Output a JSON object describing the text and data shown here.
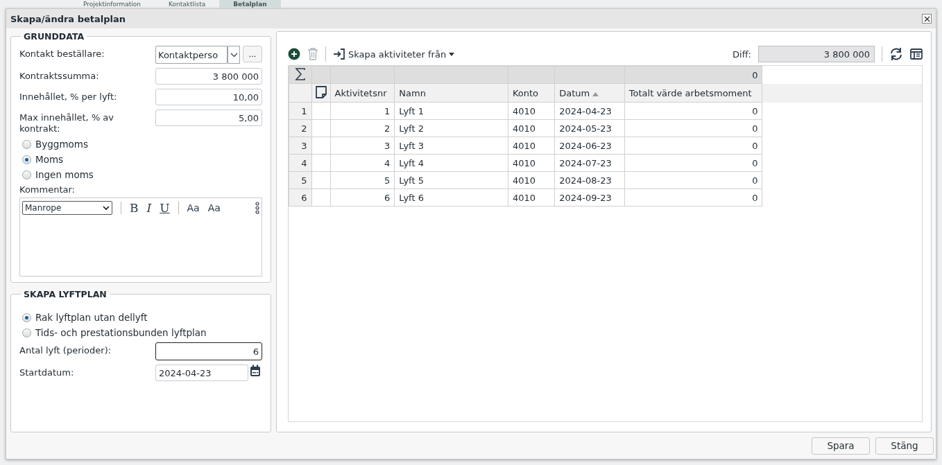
{
  "background_tabs": [
    {
      "label": "Projektinformation",
      "selected": false
    },
    {
      "label": "Kontaktlista",
      "selected": false
    },
    {
      "label": "Betalplan",
      "selected": true
    }
  ],
  "dialog": {
    "title": "Skapa/ändra betalplan"
  },
  "grunddata": {
    "legend": "GRUNDDATA",
    "contact": {
      "label": "Kontakt beställare:",
      "value": "Kontaktperso",
      "more": "..."
    },
    "fields": [
      {
        "label": "Kontraktssumma:",
        "value": "3 800 000"
      },
      {
        "label": "Innehållet, % per lyft:",
        "value": "10,00"
      },
      {
        "label": "Max innehållet, % av kontrakt:",
        "value": "5,00"
      }
    ],
    "vat_options": [
      {
        "label": "Byggmoms",
        "selected": false
      },
      {
        "label": "Moms",
        "selected": true
      },
      {
        "label": "Ingen moms",
        "selected": false
      }
    ],
    "comment": {
      "label": "Kommentar:",
      "font": "Manrope",
      "format_buttons": [
        "B",
        "I",
        "U",
        "Aa",
        "Aa"
      ]
    }
  },
  "lyftplan": {
    "legend": "SKAPA LYFTPLAN",
    "options": [
      {
        "label": "Rak lyftplan utan dellyft",
        "selected": true
      },
      {
        "label": "Tids- och prestationsbunden lyftplan",
        "selected": false
      }
    ],
    "count": {
      "label": "Antal lyft (perioder):",
      "value": "6"
    },
    "start": {
      "label": "Startdatum:",
      "value": "2024-04-23"
    }
  },
  "grid": {
    "create_label": "Skapa aktiviteter från",
    "diff_label": "Diff:",
    "diff_value": "3 800 000",
    "sum_total": "0",
    "columns": [
      "Aktivitetsnr",
      "Namn",
      "Konto",
      "Datum",
      "Totalt värde arbetsmoment"
    ],
    "rows": [
      {
        "number": "1",
        "cells": [
          "1",
          "Lyft 1",
          "4010",
          "2024-04-23",
          "0"
        ]
      },
      {
        "number": "2",
        "cells": [
          "2",
          "Lyft 2",
          "4010",
          "2024-05-23",
          "0"
        ]
      },
      {
        "number": "3",
        "cells": [
          "3",
          "Lyft 3",
          "4010",
          "2024-06-23",
          "0"
        ]
      },
      {
        "number": "4",
        "cells": [
          "4",
          "Lyft 4",
          "4010",
          "2024-07-23",
          "0"
        ]
      },
      {
        "number": "5",
        "cells": [
          "5",
          "Lyft 5",
          "4010",
          "2024-08-23",
          "0"
        ]
      },
      {
        "number": "6",
        "cells": [
          "6",
          "Lyft 6",
          "4010",
          "2024-09-23",
          "0"
        ]
      }
    ]
  },
  "footer": {
    "buttons": [
      "Spara",
      "Stäng"
    ]
  }
}
